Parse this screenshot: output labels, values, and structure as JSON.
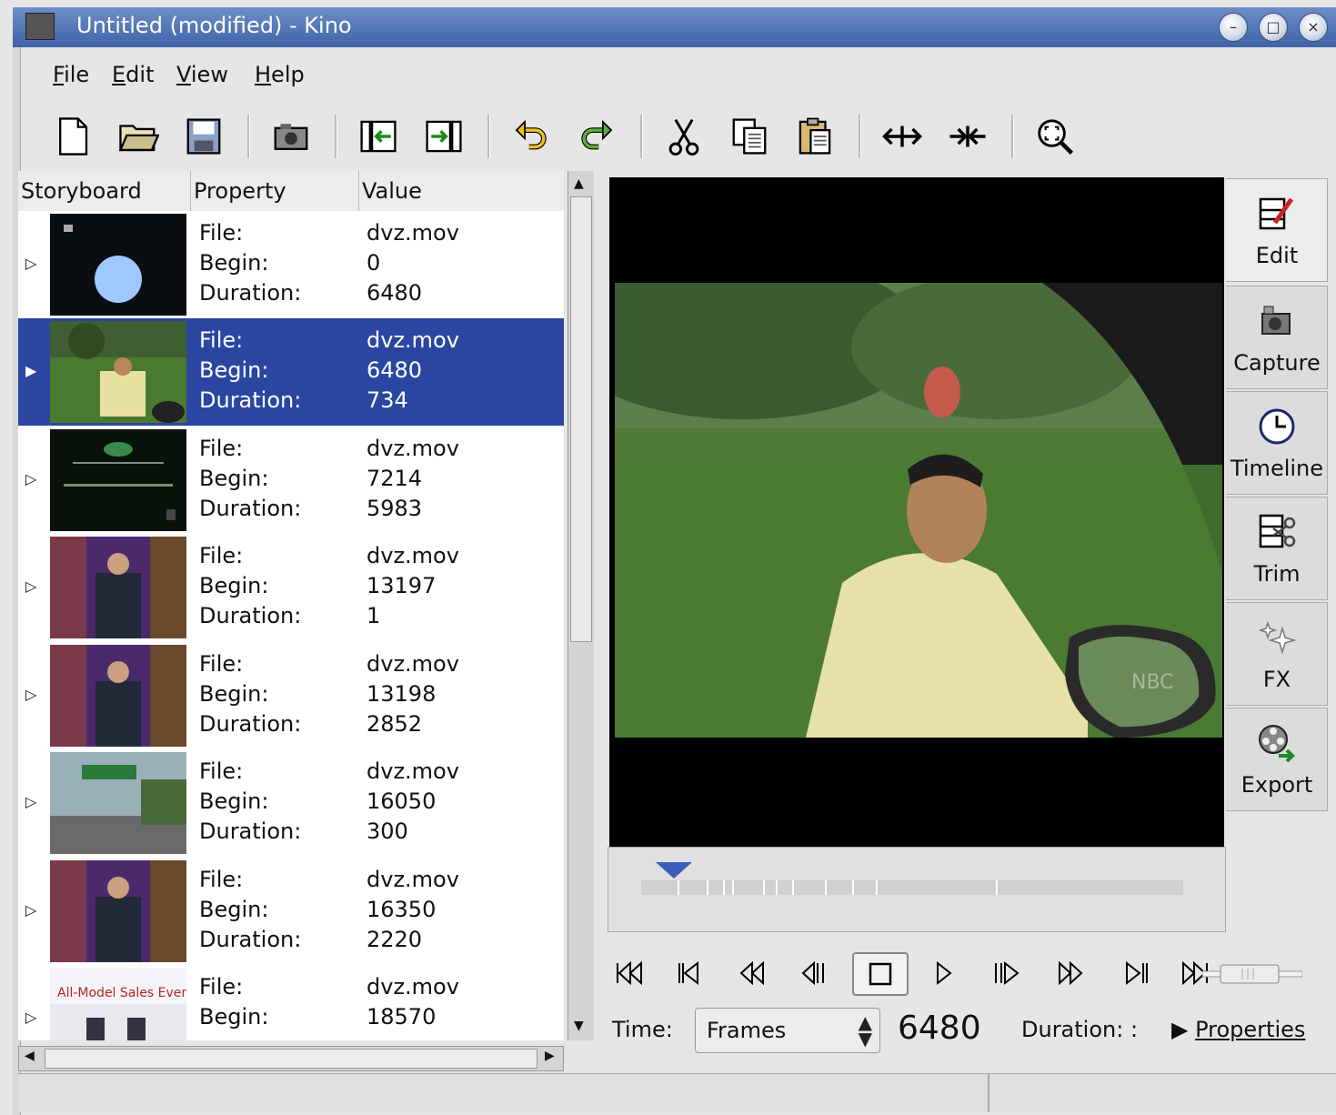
{
  "window": {
    "title": "Untitled (modified)  - Kino",
    "icons": [
      "app-icon",
      "minimize-icon",
      "maximize-icon",
      "close-icon"
    ]
  },
  "menu": [
    "File",
    "Edit",
    "View",
    "Help"
  ],
  "toolbar": {
    "icons": [
      "new-icon",
      "open-icon",
      "save-icon",
      "snapshot-icon",
      "insert-before-icon",
      "insert-after-icon",
      "undo-icon",
      "redo-icon",
      "cut-icon",
      "copy-icon",
      "paste-icon",
      "split-scene-icon",
      "join-scenes-icon",
      "zoom-fit-icon"
    ]
  },
  "storyboard": {
    "columns": [
      "Storyboard",
      "Property",
      "Value"
    ],
    "labels": [
      "File:",
      "Begin:",
      "Duration:"
    ],
    "rows": [
      {
        "file": "dvz.mov",
        "begin": "0",
        "duration": "6480",
        "selected": false,
        "thumb": "moon"
      },
      {
        "file": "dvz.mov",
        "begin": "6480",
        "duration": "734",
        "selected": true,
        "thumb": "man-grass"
      },
      {
        "file": "dvz.mov",
        "begin": "7214",
        "duration": "5983",
        "selected": false,
        "thumb": "black-logo"
      },
      {
        "file": "dvz.mov",
        "begin": "13197",
        "duration": "1",
        "selected": false,
        "thumb": "talkshow"
      },
      {
        "file": "dvz.mov",
        "begin": "13198",
        "duration": "2852",
        "selected": false,
        "thumb": "talkshow"
      },
      {
        "file": "dvz.mov",
        "begin": "16050",
        "duration": "300",
        "selected": false,
        "thumb": "highway"
      },
      {
        "file": "dvz.mov",
        "begin": "16350",
        "duration": "2220",
        "selected": false,
        "thumb": "talkshow"
      },
      {
        "file": "dvz.mov",
        "begin": "18570",
        "duration": "",
        "selected": false,
        "thumb": "sales",
        "thumb_text": "All-Model Sales Event"
      }
    ]
  },
  "modes": [
    {
      "label": "Edit",
      "icon": "edit-icon",
      "active": true
    },
    {
      "label": "Capture",
      "icon": "camera-icon",
      "active": false
    },
    {
      "label": "Timeline",
      "icon": "clock-icon",
      "active": false
    },
    {
      "label": "Trim",
      "icon": "trim-scissors-icon",
      "active": false
    },
    {
      "label": "FX",
      "icon": "sparkle-icon",
      "active": false
    },
    {
      "label": "Export",
      "icon": "film-reel-export-icon",
      "active": false
    }
  ],
  "preview": {
    "watermark": "NBC",
    "scrub_position_frames": 6480
  },
  "transport": {
    "icons": [
      "start-icon",
      "prev-scene-icon",
      "rewind-icon",
      "back-frame-icon",
      "stop-icon",
      "play-icon",
      "forward-frame-icon",
      "fast-forward-icon",
      "next-scene-icon",
      "end-icon"
    ]
  },
  "time": {
    "label": "Time:",
    "format": "Frames",
    "value": "6480",
    "duration_label": "Duration: :",
    "properties_label": "Properties"
  }
}
